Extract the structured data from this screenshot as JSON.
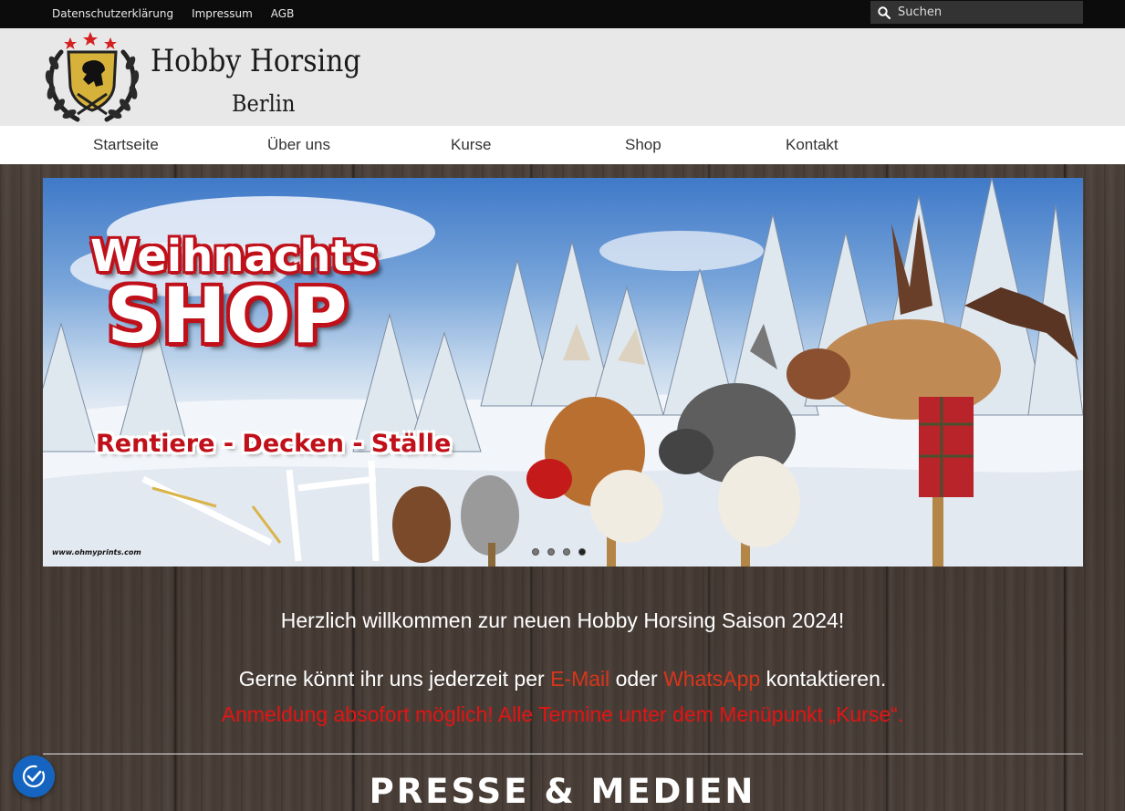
{
  "topbar": {
    "links": [
      "Datenschutzerklärung",
      "Impressum",
      "AGB"
    ],
    "search_placeholder": "Suchen"
  },
  "header": {
    "brand_name": "Hobby Horsing",
    "brand_city": "Berlin"
  },
  "nav": {
    "items": [
      "Startseite",
      "Über uns",
      "Kurse",
      "Shop",
      "Kontakt"
    ]
  },
  "slider": {
    "title_line1": "Weihnachts",
    "title_line2": "SHOP",
    "subtitle": "Rentiere - Decken - Ställe",
    "watermark": "www.ohmyprints.com",
    "slide_count": 4,
    "active_slide": 4
  },
  "content": {
    "welcome": "Herzlich willkommen zur neuen Hobby Horsing Saison 2024!",
    "contact_pre": "Gerne könnt ihr uns jederzeit per ",
    "contact_email": "E-Mail",
    "contact_mid": " oder ",
    "contact_whatsapp": "WhatsApp",
    "contact_post": " kontaktieren.",
    "notice": "Anmeldung absofort möglich! Alle Termine unter dem Menüpunkt „Kurse“.",
    "section_heading": "PRESSE & MEDIEN"
  },
  "colors": {
    "accent_link": "#d9351b",
    "notice_red": "#e41414",
    "cookie_blue": "#1565c0"
  },
  "icons": {
    "search": "search-icon",
    "cookie": "cookie-consent-icon",
    "logo": "horse-crest-logo"
  }
}
